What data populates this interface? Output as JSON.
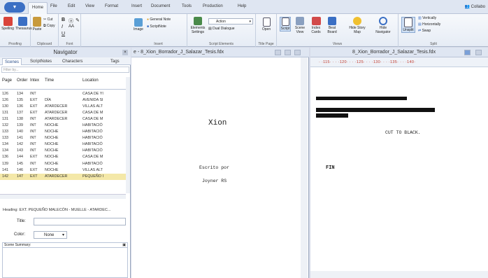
{
  "tabs": [
    "File",
    "Edit",
    "View",
    "Format",
    "Insert",
    "Document",
    "Tools",
    "Production",
    "Help"
  ],
  "active_tab": "Home",
  "user": "Collabo",
  "ribbon": {
    "proofing": {
      "label": "Proofing",
      "spelling": "Spelling",
      "thesaurus": "Thesaurus"
    },
    "clipboard": {
      "label": "Clipboard",
      "paste": "Paste",
      "cut": "Cut",
      "copy": "Copy"
    },
    "font": {
      "label": "Font"
    },
    "insert": {
      "label": "Insert",
      "image": "Image",
      "general_note": "General Note",
      "scriptnote": "ScriptNote"
    },
    "script_elements": {
      "label": "Script Elements",
      "elements_settings": "Elements Settings",
      "element_value": "Action",
      "dual_dialogue": "Dual Dialogue"
    },
    "title_page": {
      "label": "Title Page",
      "open": "Open"
    },
    "views": {
      "label": "Views",
      "script": "Script",
      "scene_view": "Scene View",
      "index_cards": "Index Cards",
      "beat_board": "Beat Board",
      "hide_story_map": "Hide Story Map",
      "hide_navigator": "Hide Navigator"
    },
    "split": {
      "label": "Split",
      "unsplit": "Unsplit",
      "vertically": "Vertically",
      "horizontally": "Horizontally",
      "swap": "Swap"
    }
  },
  "navigator": {
    "title": "Navigator",
    "tabs": [
      "Scenes",
      "ScriptNotes",
      "Characters",
      "Tags"
    ],
    "filter_placeholder": "Filter by...",
    "columns": [
      "Page",
      "Order",
      "Intex",
      "Time",
      "Location"
    ],
    "rows": [
      [
        "126",
        "134",
        "INT",
        "",
        "CASA DE YI"
      ],
      [
        "126",
        "135",
        "EXT",
        "DÍA",
        "AVENIDA SI"
      ],
      [
        "130",
        "136",
        "EXT",
        "ATARDECER",
        "VILLAS ALT"
      ],
      [
        "131",
        "137",
        "EXT",
        "ATARDECER",
        "CASA DE M"
      ],
      [
        "131",
        "138",
        "INT",
        "ATARDECER",
        "CASA DE M"
      ],
      [
        "132",
        "139",
        "INT",
        "NOCHE",
        "HABITACIÓ"
      ],
      [
        "133",
        "140",
        "INT",
        "NOCHE",
        "HABITACIÓ"
      ],
      [
        "133",
        "141",
        "INT",
        "NOCHE",
        "HABITACIÓ"
      ],
      [
        "134",
        "142",
        "INT",
        "NOCHE",
        "HABITACIÓ"
      ],
      [
        "134",
        "143",
        "INT",
        "NOCHE",
        "HABITACIÓ"
      ],
      [
        "136",
        "144",
        "EXT",
        "NOCHE",
        "CASA DE M"
      ],
      [
        "139",
        "145",
        "INT",
        "NOCHE",
        "HABITACIÓ"
      ],
      [
        "141",
        "146",
        "EXT",
        "NOCHE",
        "VILLAS ALT"
      ],
      [
        "142",
        "147",
        "EXT",
        "ATARDECER",
        "PEQUEÑO I"
      ]
    ],
    "heading": "Heading:  EXT. PEQUEÑO MALECÓN - MUELLE - ATARDEC...",
    "title_label": "Title:",
    "color_label": "Color:",
    "color_value": "None",
    "summary_label": "Scene Summary:"
  },
  "pane1": {
    "title": "e - 8_Xion_Borrador_J_Salazar_Tesis.fdx",
    "script_title": "Xion",
    "written_by": "Escrito por",
    "author": "Joyner RS"
  },
  "pane2": {
    "title": "8_Xion_Borrador_J_Salazar_Tesis.fdx",
    "ruler": "· ·115· · · ·120· · · ·125· · · ·130· · · ·135· · · ·140·",
    "transition": "CUT TO BLACK.",
    "fin": "FIN"
  }
}
